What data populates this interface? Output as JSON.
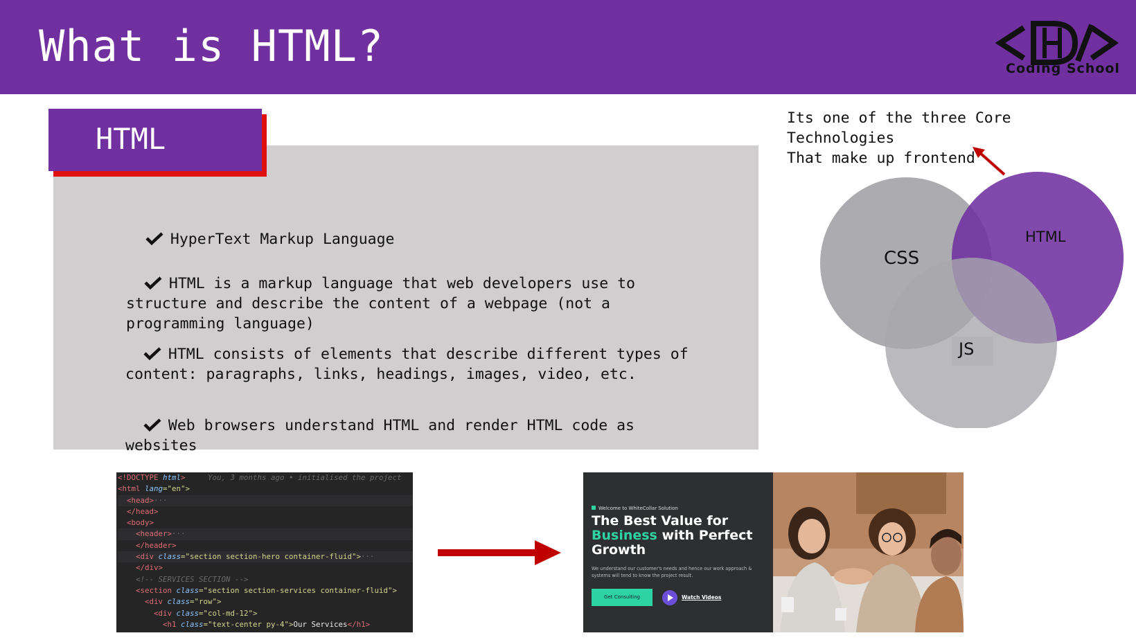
{
  "slide": {
    "title": "What is HTML?",
    "logo_text": "Coding School"
  },
  "card": {
    "tag": "HTML",
    "bullets": [
      "HyperText Markup Language",
      "HTML is a markup language that web developers use to\nstructure and describe the content of a webpage (not a\nprogramming language)",
      "HTML consists of elements that describe different types of\ncontent: paragraphs, links, headings, images, video, etc.",
      "Web browsers understand HTML and render HTML code as\nwebsites"
    ]
  },
  "note": {
    "text": "Its one of the three Core\nTechnologies\nThat make up frontend"
  },
  "venn": {
    "labels": [
      "CSS",
      "HTML",
      "JS"
    ],
    "colors": {
      "css": "#a6a6ac",
      "html": "#7030a0",
      "js": "#a6a6ac"
    }
  },
  "code": {
    "lines": [
      [
        "<!DOCTYPE ",
        "html",
        ">",
        "     You, 3 months ago • initialised the project"
      ],
      [
        "<html ",
        "lang",
        "=\"en\">"
      ],
      [
        "  <head>",
        "···"
      ],
      [
        "  </head>"
      ],
      [
        "  <body>"
      ],
      [
        "    <header>",
        "···"
      ],
      [
        "    </header>"
      ],
      [
        "    <div ",
        "class",
        "=\"section section-hero container-fluid\">",
        "···"
      ],
      [
        "    </div>"
      ],
      [
        "    <!-- SERVICES SECTION -->"
      ],
      [
        "    <section ",
        "class",
        "=\"section section-services container-fluid\">"
      ],
      [
        "      <div ",
        "class",
        "=\"row\">"
      ],
      [
        "        <div ",
        "class",
        "=\"col-md-12\">"
      ],
      [
        "          <h1 ",
        "class",
        "=\"text-center py-4\">",
        "Our Services",
        "</h1>"
      ]
    ]
  },
  "preview": {
    "kicker": "Welcome to WhiteCollar Solution",
    "headline_1": "The Best Value for ",
    "headline_green": "Business",
    "headline_2": " with Perfect Growth",
    "description": "We understand our customer's needs and hence our work approach & systems will tend to know the project result.",
    "button": "Get Consulting",
    "watch": "Watch Videos"
  },
  "colors": {
    "brand_purple": "#7030a0",
    "accent_red": "#c00000",
    "panel_gray": "#d0cece",
    "preview_green": "#2ed3a4"
  }
}
